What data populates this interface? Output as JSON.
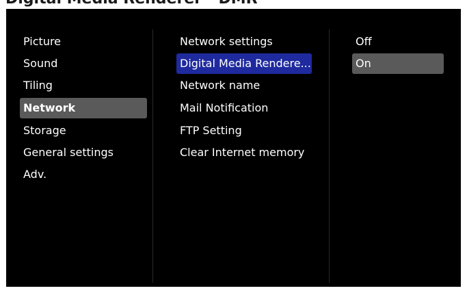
{
  "page_title": "Digital Media Renderer - DMR",
  "menu": {
    "main_items": [
      {
        "label": "Picture"
      },
      {
        "label": "Sound"
      },
      {
        "label": "Tiling"
      },
      {
        "label": "Network"
      },
      {
        "label": "Storage"
      },
      {
        "label": "General settings"
      },
      {
        "label": "Adv."
      }
    ],
    "sub_items": [
      {
        "label": "Network settings"
      },
      {
        "label": "Digital Media Rendere..."
      },
      {
        "label": "Network name"
      },
      {
        "label": "Mail Notification"
      },
      {
        "label": "FTP Setting"
      },
      {
        "label": "Clear Internet memory"
      }
    ],
    "options": [
      {
        "label": "Off"
      },
      {
        "label": "On"
      }
    ]
  },
  "colors": {
    "screen_bg": "#000000",
    "text": "#ffffff",
    "main_selected_bg": "#5a5a5a",
    "sub_selected_bg": "#1e2a9e",
    "option_selected_bg": "#5a5a5a"
  }
}
